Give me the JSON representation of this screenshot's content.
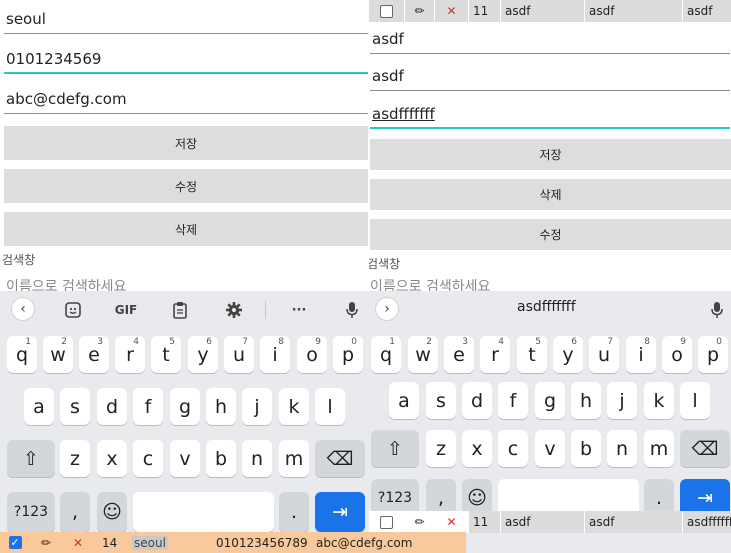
{
  "left": {
    "fields": [
      {
        "value": "seoul"
      },
      {
        "value": "0101234569"
      },
      {
        "value": "abc@cdefg.com"
      }
    ],
    "buttons": [
      "저장",
      "수정",
      "삭제"
    ],
    "search_label": "검색창",
    "search_placeholder": "이름으로 검색하세요",
    "keyboard_toolbar": {
      "gif": "GIF",
      "more": "···"
    }
  },
  "right": {
    "top_row": {
      "id": "11",
      "c1": "asdf",
      "c2": "asdf",
      "c3": "asdf"
    },
    "fields": [
      {
        "value": "asdf"
      },
      {
        "value": "asdf"
      },
      {
        "value": "asdfffffff"
      }
    ],
    "buttons": [
      "저장",
      "삭제",
      "수정"
    ],
    "search_label": "검색창",
    "search_placeholder": "이름으로 검색하세요",
    "suggestion": "asdfffffff",
    "bottom_row": {
      "id": "11",
      "c1": "asdf",
      "c2": "asdf",
      "c3": "asdfffffff"
    }
  },
  "keyboard": {
    "row1": [
      {
        "k": "q",
        "h": "1"
      },
      {
        "k": "w",
        "h": "2"
      },
      {
        "k": "e",
        "h": "3"
      },
      {
        "k": "r",
        "h": "4"
      },
      {
        "k": "t",
        "h": "5"
      },
      {
        "k": "y",
        "h": "6"
      },
      {
        "k": "u",
        "h": "7"
      },
      {
        "k": "i",
        "h": "8"
      },
      {
        "k": "o",
        "h": "9"
      },
      {
        "k": "p",
        "h": "0"
      }
    ],
    "row2": [
      "a",
      "s",
      "d",
      "f",
      "g",
      "h",
      "j",
      "k",
      "l"
    ],
    "row3": [
      "z",
      "x",
      "c",
      "v",
      "b",
      "n",
      "m"
    ],
    "sym": "?123",
    "comma": ",",
    "period": ".",
    "shift": "⇧",
    "backspace": "⌫",
    "emoji": "☺",
    "enter": "⇥"
  },
  "bottom_bar": {
    "id": "14",
    "name": "seoul",
    "phone": "010123456789",
    "email": "abc@cdefg.com"
  },
  "icons": {
    "edit": "✏",
    "delete": "✕",
    "check": "✓"
  },
  "colors": {
    "accent": "#26c6c6",
    "keyboard_bg": "#e8eaed",
    "enter_key": "#1a73e8",
    "selected_row": "#f9c99b",
    "delete_icon": "#d32f2f"
  }
}
